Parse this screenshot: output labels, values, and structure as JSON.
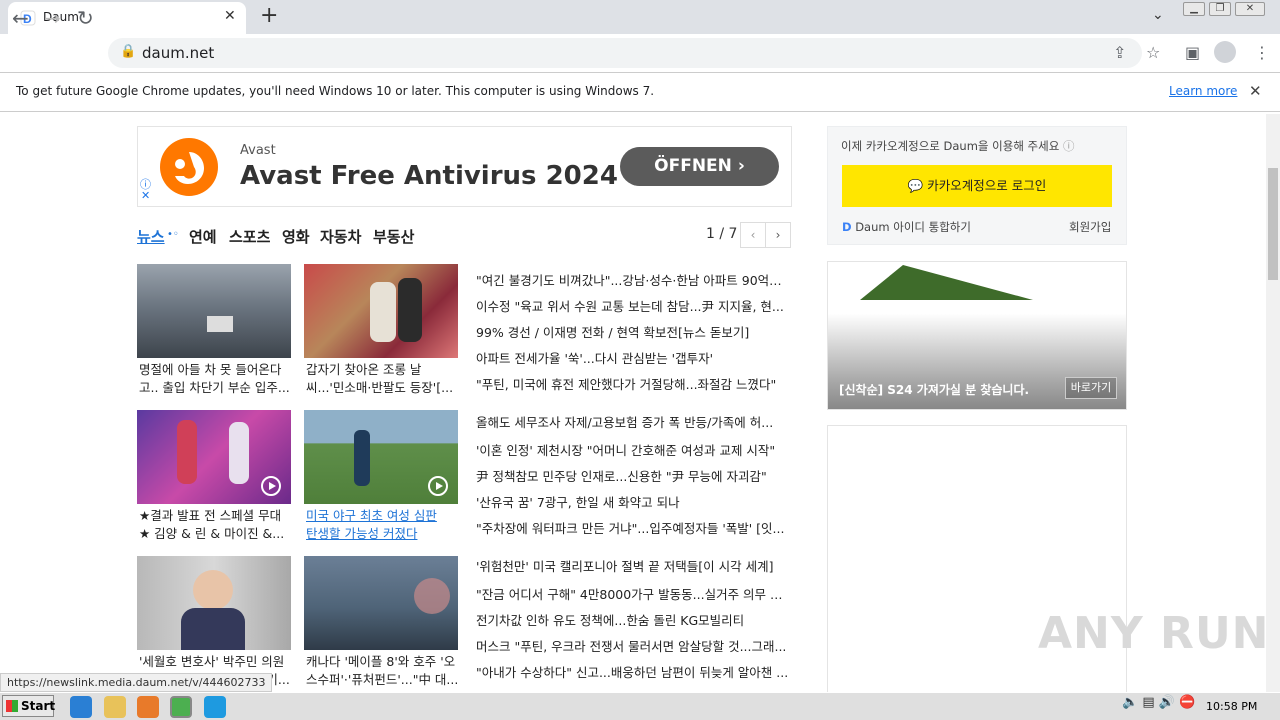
{
  "browser": {
    "tab_title": "Daum",
    "url": "daum.net",
    "infobar_text": "To get future Google Chrome updates, you'll need Windows 10 or later. This computer is using Windows 7.",
    "learn_more": "Learn more"
  },
  "ad": {
    "brand": "Avast",
    "headline": "Avast Free Antivirus 2024",
    "cta": "ÖFFNEN",
    "brand_color": "#ff7800"
  },
  "news": {
    "tabs": [
      "뉴스",
      "연예",
      "스포츠",
      "영화",
      "자동차",
      "부동산"
    ],
    "pager": "1 / 7",
    "thumbs": [
      {
        "caption1": "명절에 아들 차 못 들어온다",
        "caption2": "고.. 출입 차단기 부순 입주..."
      },
      {
        "caption1": "갑자기 찾아온 조롱 날",
        "caption2": "씨...'민소매·반팔도 등장'[..."
      },
      {
        "caption1": "★결과 발표 전 스페셜 무대",
        "caption2": "★ 김양 & 린 & 마이진 &..."
      },
      {
        "caption1": "미국 야구 최초 여성 심판",
        "caption2": "탄생할 가능성 커졌다"
      },
      {
        "caption1": "'세월호 변호사' 박주민 의원",
        "caption2": "...의 기..."
      },
      {
        "caption1": "캐나다 '메이플 8'와 호주 '오",
        "caption2": "스수퍼'·'퓨처펀드'...\"中 대..."
      }
    ],
    "headlines": [
      "\"여긴 불경기도 비껴갔나\"...강남·성수·한남 아파트 90억대 ...",
      "이수정 \"육교 위서 수원 교통 보는데 참담...尹 지지율, 현...",
      "99% 경선 / 이재명 전화 / 현역 확보전[뉴스 돋보기]",
      "아파트 전세가율 '쑥'...다시 관심받는 '갭투자'",
      "\"푸틴, 미국에 휴전 제안했다가 거절당해...좌절감 느꼈다\"",
      "올해도 세무조사 자제/고용보험 증가 폭 반등/가족에 허...",
      "'이혼 인정' 제천시장 \"어머니 간호해준 여성과 교제 시작\"",
      "尹 정책참모 민주당 인재로...신용한 \"尹 무능에 자괴감\"",
      "'산유국 꿈' 7광구, 한일 새 화약고 되나",
      "\"주차장에 워터파크 만든 거냐\"...입주예정자들 '폭발' [잇...",
      "'위험천만' 미국 캘리포니아 절벽 끝 저택들[이 시각 세계]",
      "\"잔금 어디서 구해\" 4만8000가구 발동동...실거주 의무 완...",
      "전기차값 인하 유도 정책에...한숨 돌린 KG모빌리티",
      "머스크 \"푸틴, 우크라 전쟁서 물러서면 암살당할 것...그래...",
      "\"아내가 수상하다\" 신고...배웅하던 남편이 뒤늦게 알아챈 ..."
    ]
  },
  "right": {
    "login_tip": "이제 카카오계정으로 Daum을 이용해 주세요",
    "login_button": "카카오계정으로 로그인",
    "integrate": "Daum 아이디 통합하기",
    "signup": "회원가입",
    "banner_text": "[신착순] S24 가져가실 분 찾습니다.",
    "banner_button": "바로가기"
  },
  "status_link": "https://newslink.media.daum.net/v/444602733",
  "watermark": "ANY RUN",
  "taskbar": {
    "start": "Start",
    "clock": "10:58 PM"
  }
}
